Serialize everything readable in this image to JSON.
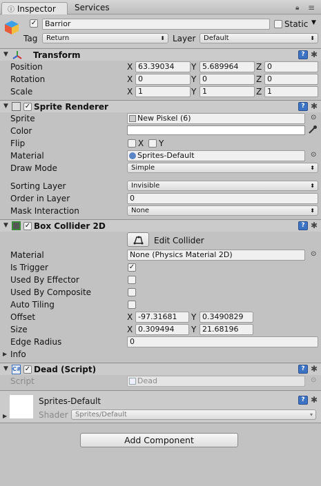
{
  "tabs": {
    "inspector": "Inspector",
    "services": "Services"
  },
  "gameobject": {
    "active": true,
    "name": "Barrior",
    "static_label": "Static",
    "static_checked": false,
    "tag_label": "Tag",
    "tag_value": "Return",
    "layer_label": "Layer",
    "layer_value": "Default"
  },
  "transform": {
    "title": "Transform",
    "position_label": "Position",
    "rotation_label": "Rotation",
    "scale_label": "Scale",
    "x": "X",
    "y": "Y",
    "z": "Z",
    "position": [
      "63.39034",
      "5.689964",
      "0"
    ],
    "rotation": [
      "0",
      "0",
      "0"
    ],
    "scale": [
      "1",
      "1",
      "1"
    ]
  },
  "sprite_renderer": {
    "title": "Sprite Renderer",
    "enabled": true,
    "sprite_label": "Sprite",
    "sprite_value": "New Piskel (6)",
    "color_label": "Color",
    "color_value": "#ffffff",
    "flip_label": "Flip",
    "flip_x": "X",
    "flip_y": "Y",
    "material_label": "Material",
    "material_value": "Sprites-Default",
    "draw_mode_label": "Draw Mode",
    "draw_mode_value": "Simple",
    "sorting_layer_label": "Sorting Layer",
    "sorting_layer_value": "Invisible",
    "order_label": "Order in Layer",
    "order_value": "0",
    "mask_label": "Mask Interaction",
    "mask_value": "None"
  },
  "box_collider": {
    "title": "Box Collider 2D",
    "enabled": true,
    "edit_collider": "Edit Collider",
    "material_label": "Material",
    "material_value": "None (Physics Material 2D)",
    "is_trigger_label": "Is Trigger",
    "is_trigger": true,
    "used_by_effector_label": "Used By Effector",
    "used_by_composite_label": "Used By Composite",
    "auto_tiling_label": "Auto Tiling",
    "offset_label": "Offset",
    "offset": [
      "-97.31681",
      "0.3490829"
    ],
    "size_label": "Size",
    "size": [
      "0.309494",
      "21.68196"
    ],
    "edge_radius_label": "Edge Radius",
    "edge_radius_value": "0",
    "info_label": "Info",
    "x": "X",
    "y": "Y"
  },
  "dead_script": {
    "title": "Dead (Script)",
    "script_label": "Script",
    "script_value": "Dead"
  },
  "material": {
    "name": "Sprites-Default",
    "shader_label": "Shader",
    "shader_value": "Sprites/Default"
  },
  "add_component": "Add Component",
  "icons": {
    "help": "?",
    "check": "✓",
    "gear": "✱",
    "target": "⊙",
    "tri_down": "▼",
    "tri_right": "▶",
    "dd": "⬍"
  }
}
